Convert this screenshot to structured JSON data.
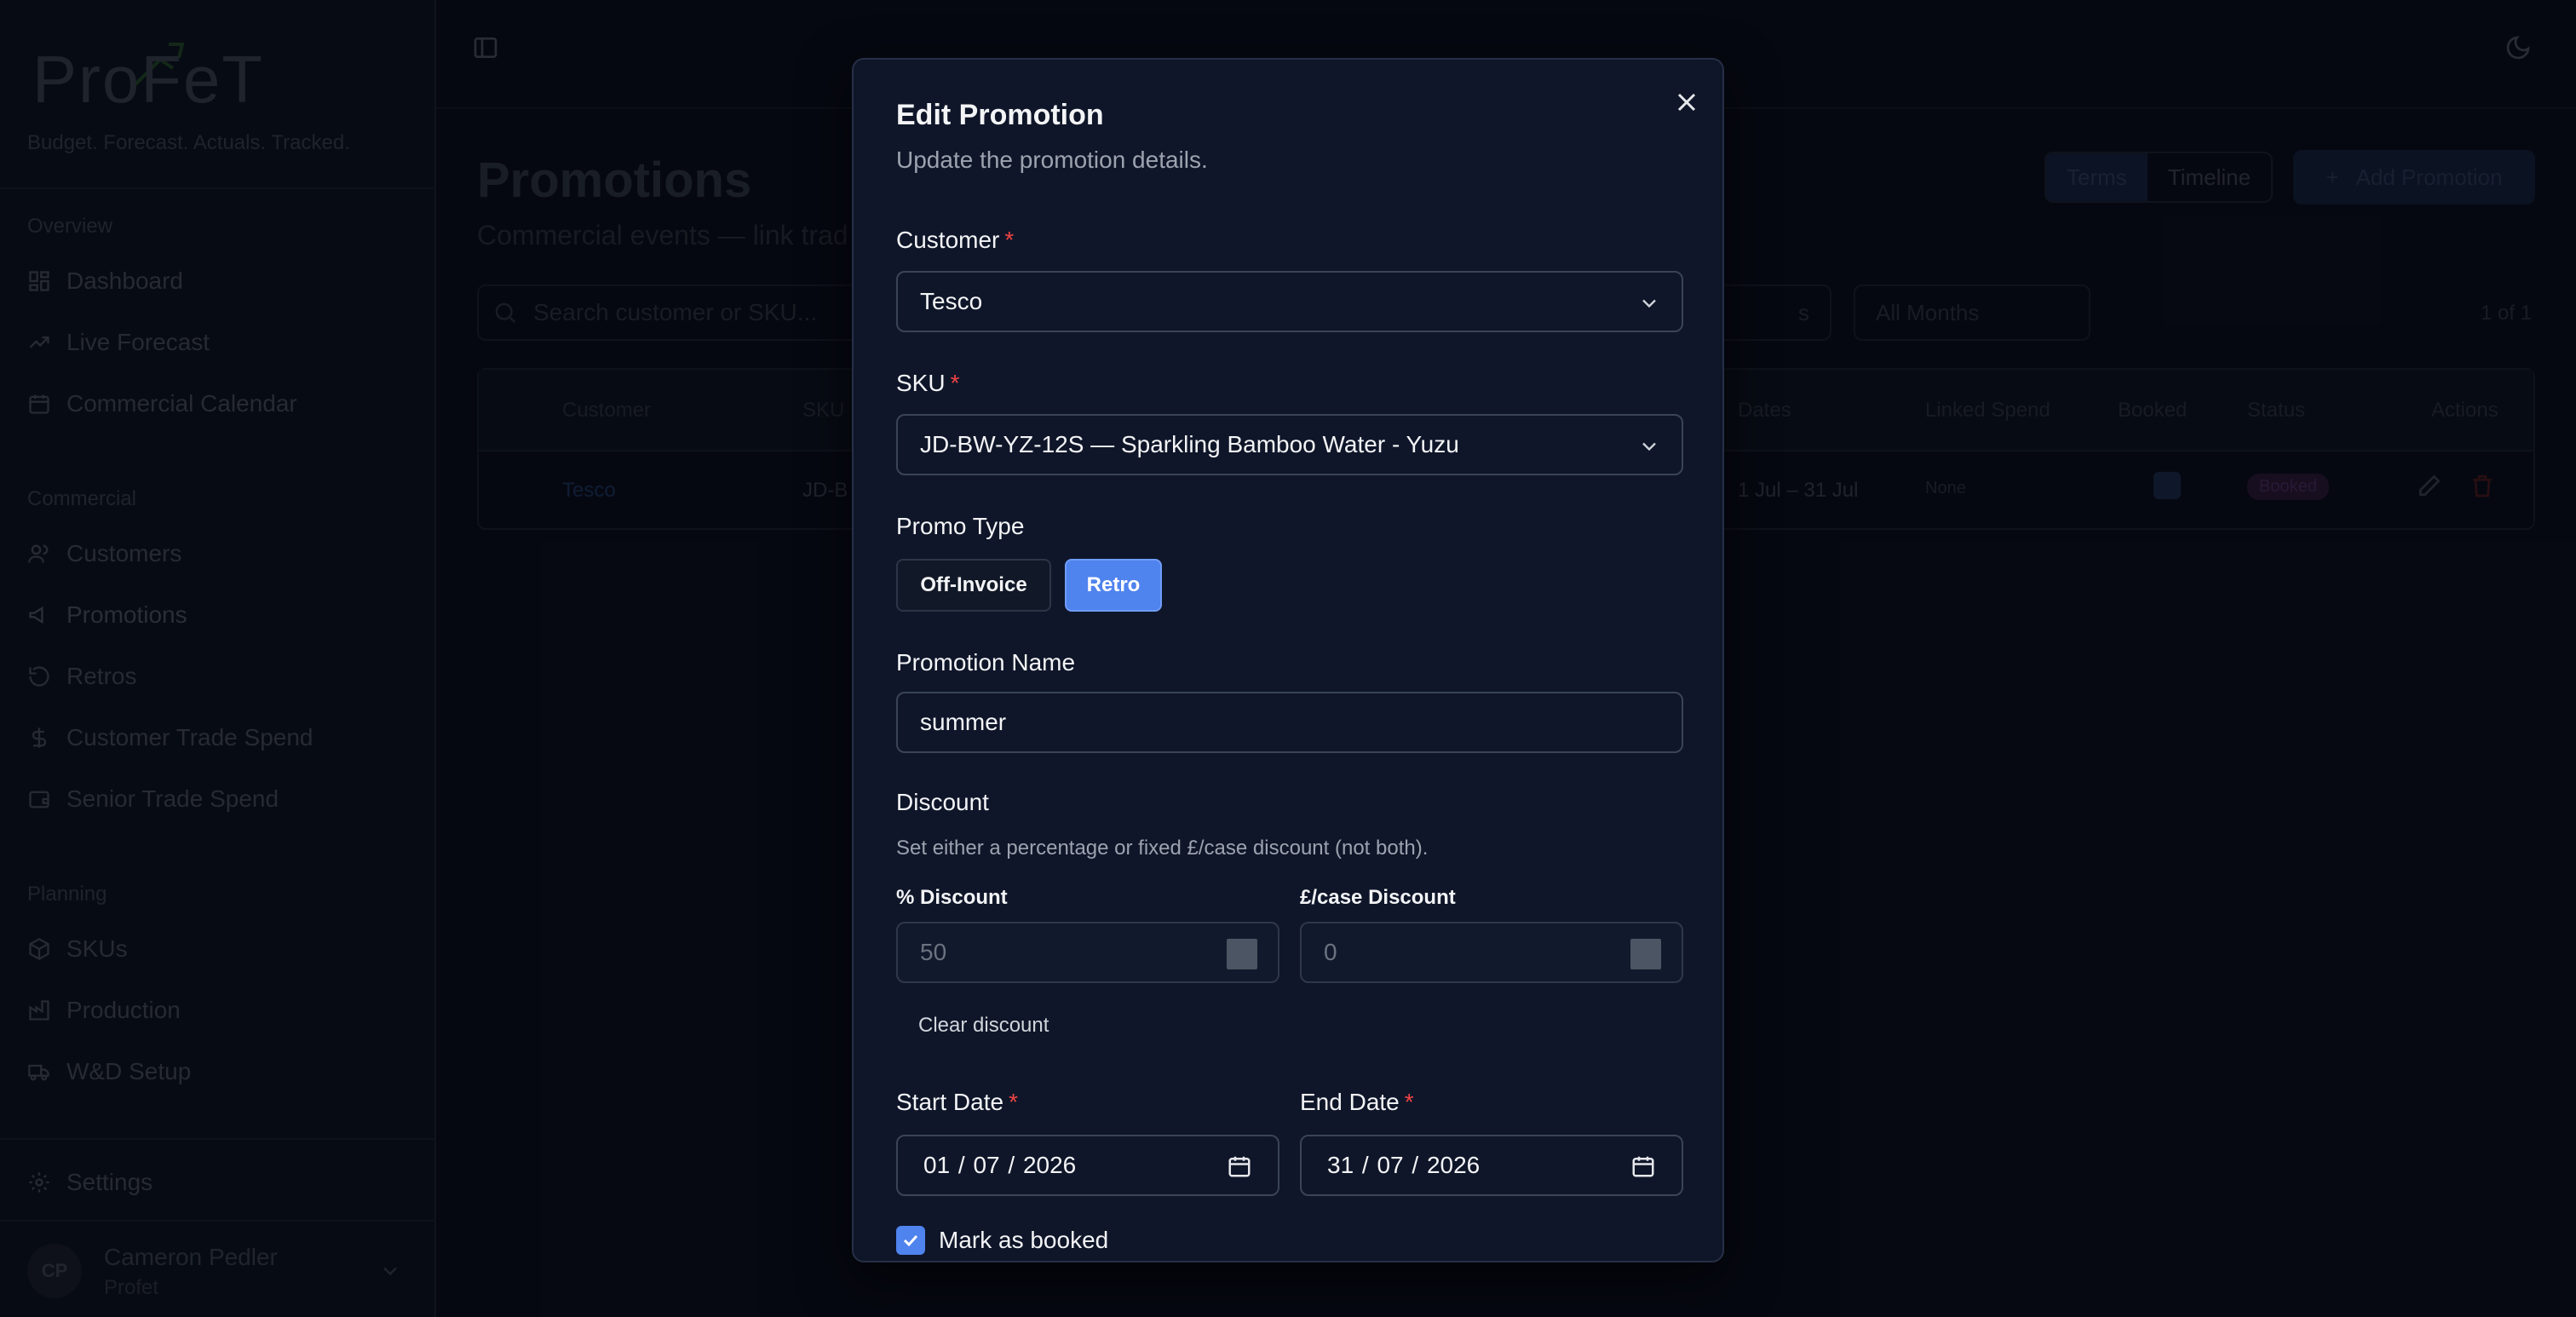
{
  "sidebar": {
    "brand_letters": "ProFeT",
    "tagline": "Budget. Forecast. Actuals. Tracked.",
    "sections": [
      "Overview",
      "Commercial",
      "Planning"
    ],
    "items": [
      {
        "label": "Dashboard",
        "icon": "dashboard-icon"
      },
      {
        "label": "Live Forecast",
        "icon": "trend-icon"
      },
      {
        "label": "Commercial Calendar",
        "icon": "calendar-icon"
      },
      {
        "label": "Customers",
        "icon": "users-icon"
      },
      {
        "label": "Promotions",
        "icon": "megaphone-icon"
      },
      {
        "label": "Retros",
        "icon": "rotate-icon"
      },
      {
        "label": "Customer Trade Spend",
        "icon": "dollar-icon"
      },
      {
        "label": "Senior Trade Spend",
        "icon": "wallet-icon"
      },
      {
        "label": "SKUs",
        "icon": "box-icon"
      },
      {
        "label": "Production",
        "icon": "factory-icon"
      },
      {
        "label": "W&D Setup",
        "icon": "truck-icon"
      }
    ],
    "settings_label": "Settings",
    "user": {
      "initials": "CP",
      "name": "Cameron Pedler",
      "org": "Profet"
    }
  },
  "page": {
    "title": "Promotions",
    "subtitle": "Commercial events — link trad",
    "view_toggle": [
      "Terms",
      "Timeline"
    ],
    "add_label": "Add Promotion",
    "search_placeholder": "Search customer or SKU...",
    "filter_months": "All Months",
    "filter_partial": "s",
    "count": "1 of 1",
    "table": {
      "headers": [
        "Customer",
        "SKU",
        "Dates",
        "Linked Spend",
        "Booked",
        "Status",
        "Actions"
      ],
      "row": {
        "customer": "Tesco",
        "sku": "JD-B",
        "dates": "1 Jul – 31 Jul",
        "linked_spend": "None",
        "status": "Booked"
      }
    }
  },
  "modal": {
    "title": "Edit Promotion",
    "subtitle": "Update the promotion details.",
    "customer_label": "Customer",
    "customer_value": "Tesco",
    "sku_label": "SKU",
    "sku_value": "JD-BW-YZ-12S — Sparkling Bamboo Water - Yuzu",
    "promo_type_label": "Promo Type",
    "promo_types": [
      "Off-Invoice",
      "Retro"
    ],
    "promo_type_selected": "Retro",
    "name_label": "Promotion Name",
    "name_value": "summer",
    "discount_label": "Discount",
    "discount_help": "Set either a percentage or fixed £/case discount (not both).",
    "pct_label": "% Discount",
    "pct_value": "50",
    "case_label": "£/case Discount",
    "case_value": "0",
    "clear_label": "Clear discount",
    "start_label": "Start Date",
    "start_value": "01 / 07 / 2026",
    "end_label": "End Date",
    "end_value": "31 / 07 / 2026",
    "booked_label": "Mark as booked",
    "booked_checked": true
  },
  "colors": {
    "accent": "#4f83ee",
    "required": "#ef4444",
    "modal_bg": "#0f1629"
  }
}
